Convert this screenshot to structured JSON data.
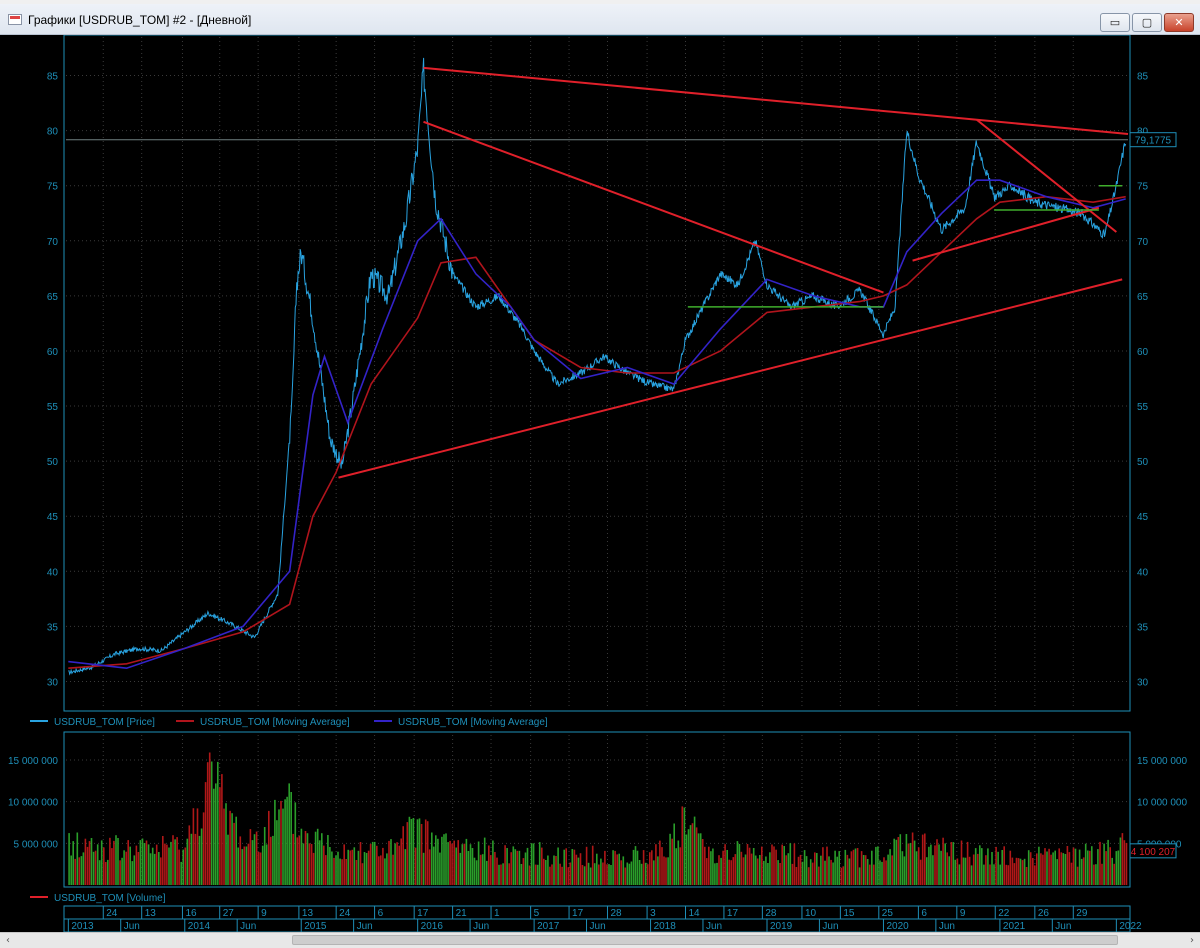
{
  "window": {
    "title": "Графики [USDRUB_TOM] #2 - [Дневной]",
    "buttons": {
      "minimize": "▭",
      "restore": "▢",
      "close": "✕"
    }
  },
  "scrollbar": {
    "left_arrow": "‹",
    "right_arrow": "›"
  },
  "colors": {
    "background": "#000000",
    "price": "#29a3e0",
    "ma_red": "#b0141c",
    "ma_blue": "#3323c8",
    "trend": "#e0202a",
    "support_green": "#3fae2c",
    "axis": "#1e8fb8",
    "grid": "#3a3a3a"
  },
  "chart_data": [
    {
      "type": "line",
      "title": "",
      "ylim": [
        27.5,
        88.5
      ],
      "y_ticks": [
        30,
        35,
        40,
        45,
        50,
        55,
        60,
        65,
        70,
        75,
        80,
        85
      ],
      "current_price_label": "79,1775",
      "current_price": 79.1775,
      "grid": true,
      "legend": [
        {
          "name": "USDRUB_TOM [Price]",
          "color": "#29a3e0"
        },
        {
          "name": "USDRUB_TOM [Moving Average]",
          "color": "#b0141c"
        },
        {
          "name": "USDRUB_TOM [Moving Average]",
          "color": "#3323c8"
        }
      ],
      "series": [
        {
          "name": "USDRUB_TOM [Price]",
          "x": [
            2013.0,
            2013.2,
            2013.4,
            2013.6,
            2013.8,
            2014.0,
            2014.2,
            2014.4,
            2014.6,
            2014.8,
            2014.92,
            2014.96,
            2015.0,
            2015.1,
            2015.25,
            2015.35,
            2015.45,
            2015.6,
            2015.75,
            2015.9,
            2016.0,
            2016.05,
            2016.15,
            2016.3,
            2016.5,
            2016.7,
            2016.9,
            2017.0,
            2017.2,
            2017.4,
            2017.6,
            2017.8,
            2018.0,
            2018.2,
            2018.3,
            2018.4,
            2018.6,
            2018.75,
            2018.9,
            2019.0,
            2019.2,
            2019.4,
            2019.6,
            2019.8,
            2020.0,
            2020.1,
            2020.2,
            2020.3,
            2020.5,
            2020.7,
            2020.8,
            2020.95,
            2021.1,
            2021.3,
            2021.5,
            2021.7,
            2021.9,
            2022.0,
            2022.08
          ],
          "values": [
            30.8,
            31.3,
            32.5,
            33.0,
            32.8,
            34.5,
            36.2,
            35.2,
            34.0,
            38.0,
            55.0,
            66.0,
            69.0,
            63.0,
            52.0,
            49.5,
            56.0,
            67.0,
            65.0,
            72.0,
            78.5,
            85.5,
            74.0,
            67.0,
            64.0,
            65.0,
            62.0,
            60.0,
            57.0,
            58.0,
            59.5,
            58.0,
            57.0,
            56.5,
            61.0,
            63.0,
            67.0,
            66.0,
            70.0,
            66.0,
            64.0,
            65.0,
            64.0,
            65.5,
            61.5,
            64.0,
            80.0,
            76.0,
            71.0,
            73.0,
            79.0,
            74.0,
            75.0,
            73.5,
            73.0,
            72.5,
            70.5,
            75.0,
            79.2
          ]
        },
        {
          "name": "USDRUB_TOM [Moving Average]",
          "x": [
            2013.0,
            2013.5,
            2014.0,
            2014.5,
            2014.9,
            2015.1,
            2015.3,
            2015.6,
            2016.0,
            2016.2,
            2016.5,
            2016.8,
            2017.0,
            2017.4,
            2017.8,
            2018.2,
            2018.6,
            2019.0,
            2019.4,
            2019.8,
            2020.0,
            2020.2,
            2020.5,
            2020.8,
            2021.0,
            2021.4,
            2021.8,
            2022.08
          ],
          "values": [
            31.2,
            31.6,
            33.0,
            34.5,
            37.0,
            45.0,
            49.0,
            57.0,
            63.0,
            68.0,
            68.5,
            64.0,
            61.0,
            58.5,
            58.0,
            58.0,
            60.0,
            63.5,
            64.0,
            64.5,
            65.0,
            66.0,
            69.0,
            72.0,
            73.5,
            74.0,
            73.5,
            74.0
          ]
        },
        {
          "name": "USDRUB_TOM [Moving Average]",
          "x": [
            2013.0,
            2013.5,
            2014.0,
            2014.5,
            2014.9,
            2015.1,
            2015.2,
            2015.4,
            2015.7,
            2016.0,
            2016.2,
            2016.5,
            2016.8,
            2017.0,
            2017.4,
            2017.8,
            2018.2,
            2018.6,
            2019.0,
            2019.4,
            2019.8,
            2020.0,
            2020.2,
            2020.5,
            2020.8,
            2021.0,
            2021.4,
            2021.8,
            2022.08
          ],
          "values": [
            31.8,
            31.2,
            33.0,
            35.0,
            40.0,
            56.0,
            59.5,
            53.5,
            62.0,
            70.0,
            72.0,
            67.0,
            64.0,
            61.0,
            57.5,
            58.5,
            57.0,
            62.0,
            66.5,
            65.0,
            64.0,
            64.0,
            69.0,
            72.5,
            75.5,
            75.5,
            74.0,
            73.0,
            73.8
          ]
        }
      ],
      "trendlines": [
        {
          "x": [
            2016.05,
            2022.1
          ],
          "y": [
            85.7,
            79.7
          ]
        },
        {
          "x": [
            2016.05,
            2020.0
          ],
          "y": [
            80.8,
            65.3
          ]
        },
        {
          "x": [
            2015.32,
            2022.05
          ],
          "y": [
            48.5,
            66.5
          ]
        },
        {
          "x": [
            2020.25,
            2021.85
          ],
          "y": [
            68.2,
            73.0
          ]
        },
        {
          "x": [
            2020.8,
            2022.0
          ],
          "y": [
            81.0,
            70.8
          ]
        }
      ],
      "support_lines": [
        {
          "x": [
            2018.32,
            2020.0
          ],
          "y": [
            64.0,
            64.0
          ]
        },
        {
          "x": [
            2020.95,
            2021.85
          ],
          "y": [
            72.8,
            72.8
          ]
        },
        {
          "x": [
            2021.85,
            2022.05
          ],
          "y": [
            75.0,
            75.0
          ]
        }
      ]
    },
    {
      "type": "bar",
      "title": "",
      "ylim": [
        0,
        18000000
      ],
      "y_ticks": [
        5000000,
        10000000,
        15000000
      ],
      "y_tick_labels": [
        "5 000 000",
        "10 000 000",
        "15 000 000"
      ],
      "current_volume_label": "4 100 207",
      "current_volume": 4100207,
      "grid": true,
      "legend": [
        {
          "name": "USDRUB_TOM [Volume]",
          "color": "#e0202a"
        }
      ],
      "series": [
        {
          "name": "USDRUB_TOM [Volume]",
          "x": [
            2013.0,
            2013.5,
            2014.0,
            2014.2,
            2014.5,
            2014.9,
            2015.0,
            2015.3,
            2015.8,
            2016.0,
            2016.1,
            2016.5,
            2017.0,
            2017.5,
            2018.0,
            2018.3,
            2018.5,
            2019.0,
            2019.5,
            2020.0,
            2020.2,
            2020.5,
            2021.0,
            2021.5,
            2022.0,
            2022.08
          ],
          "values": [
            6500000,
            5500000,
            6200000,
            17300000,
            6500000,
            12000000,
            8000000,
            6000000,
            5500000,
            9500000,
            7000000,
            5500000,
            5000000,
            4500000,
            4500000,
            9800000,
            5500000,
            5000000,
            4500000,
            4500000,
            7000000,
            5500000,
            4500000,
            4500000,
            5500000,
            9000000
          ]
        }
      ]
    }
  ],
  "time_axis": {
    "days": [
      {
        "label": "24",
        "t": 2013.3
      },
      {
        "label": "13",
        "t": 2013.63
      },
      {
        "label": "16",
        "t": 2013.98
      },
      {
        "label": "27",
        "t": 2014.3
      },
      {
        "label": "9",
        "t": 2014.63
      },
      {
        "label": "13",
        "t": 2014.98
      },
      {
        "label": "24",
        "t": 2015.3
      },
      {
        "label": "6",
        "t": 2015.63
      },
      {
        "label": "17",
        "t": 2015.97
      },
      {
        "label": "21",
        "t": 2016.3
      },
      {
        "label": "1",
        "t": 2016.63
      },
      {
        "label": "5",
        "t": 2016.97
      },
      {
        "label": "17",
        "t": 2017.3
      },
      {
        "label": "28",
        "t": 2017.63
      },
      {
        "label": "3",
        "t": 2017.97
      },
      {
        "label": "14",
        "t": 2018.3
      },
      {
        "label": "17",
        "t": 2018.63
      },
      {
        "label": "28",
        "t": 2018.96
      },
      {
        "label": "10",
        "t": 2019.3
      },
      {
        "label": "15",
        "t": 2019.63
      },
      {
        "label": "25",
        "t": 2019.96
      },
      {
        "label": "6",
        "t": 2020.3
      },
      {
        "label": "9",
        "t": 2020.63
      },
      {
        "label": "22",
        "t": 2020.96
      },
      {
        "label": "26",
        "t": 2021.3
      },
      {
        "label": "29",
        "t": 2021.63
      }
    ],
    "periods": [
      {
        "label": "2013",
        "t": 2013.0
      },
      {
        "label": "Jun",
        "t": 2013.45
      },
      {
        "label": "2014",
        "t": 2014.0
      },
      {
        "label": "Jun",
        "t": 2014.45
      },
      {
        "label": "2015",
        "t": 2015.0
      },
      {
        "label": "Jun",
        "t": 2015.45
      },
      {
        "label": "2016",
        "t": 2016.0
      },
      {
        "label": "Jun",
        "t": 2016.45
      },
      {
        "label": "2017",
        "t": 2017.0
      },
      {
        "label": "Jun",
        "t": 2017.45
      },
      {
        "label": "2018",
        "t": 2018.0
      },
      {
        "label": "Jun",
        "t": 2018.45
      },
      {
        "label": "2019",
        "t": 2019.0
      },
      {
        "label": "Jun",
        "t": 2019.45
      },
      {
        "label": "2020",
        "t": 2020.0
      },
      {
        "label": "Jun",
        "t": 2020.45
      },
      {
        "label": "2021",
        "t": 2021.0
      },
      {
        "label": "Jun",
        "t": 2021.45
      },
      {
        "label": "2022",
        "t": 2022.0
      }
    ]
  }
}
